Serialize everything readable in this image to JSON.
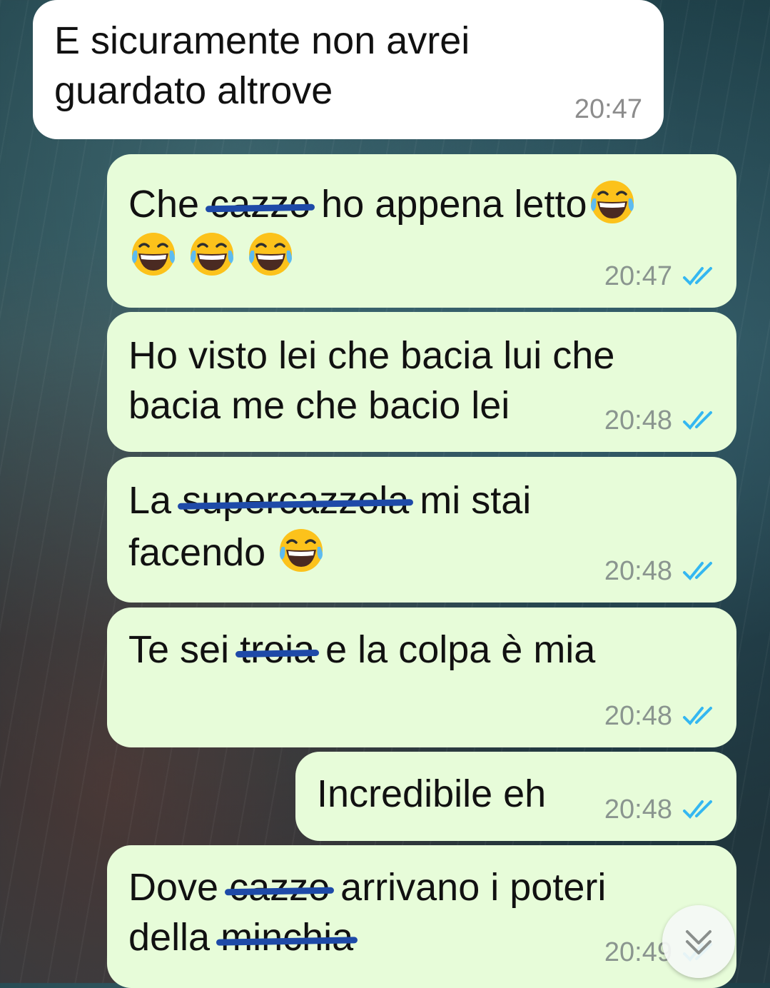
{
  "messages": [
    {
      "id": "m1",
      "direction": "incoming",
      "time": "20:47",
      "lines": [
        [
          "E sicuramente non avrei"
        ],
        [
          "guardato altrove"
        ]
      ]
    },
    {
      "id": "m2",
      "direction": "outgoing",
      "time": "20:47",
      "status": "read",
      "text": {
        "w1": "Che ",
        "struck1": "cazzo",
        "w2": " ho appena letto"
      }
    },
    {
      "id": "m3",
      "direction": "outgoing",
      "time": "20:48",
      "status": "read",
      "lines": [
        "Ho visto lei che bacia lui che",
        "bacia me che bacio lei"
      ]
    },
    {
      "id": "m4",
      "direction": "outgoing",
      "time": "20:48",
      "status": "read",
      "text": {
        "w1": "La ",
        "struck1": "supercazzola",
        "w2": " mi stai",
        "line2": "facendo "
      }
    },
    {
      "id": "m5",
      "direction": "outgoing",
      "time": "20:48",
      "status": "read",
      "text": {
        "w1": "Te sei ",
        "struck1": "troia",
        "w2": " e la colpa è mia"
      }
    },
    {
      "id": "m6",
      "direction": "outgoing",
      "time": "20:48",
      "status": "read",
      "text": {
        "w1": "Incredibile eh"
      }
    },
    {
      "id": "m7",
      "direction": "outgoing",
      "time": "20:49",
      "status": "read",
      "text": {
        "w1": "Dove ",
        "struck1": "cazzo",
        "w2": " arrivano i poteri",
        "line2": "della ",
        "struck2": "minchia"
      }
    }
  ],
  "colors": {
    "incoming": "#ffffff",
    "outgoing": "#e7fcd9",
    "read_ticks": "#34b7f1",
    "strike": "#1e4aa8"
  },
  "icons": {
    "emoji": "face-with-tears-of-joy",
    "scroll": "double-chevron-down-icon",
    "status": "double-check-icon"
  }
}
